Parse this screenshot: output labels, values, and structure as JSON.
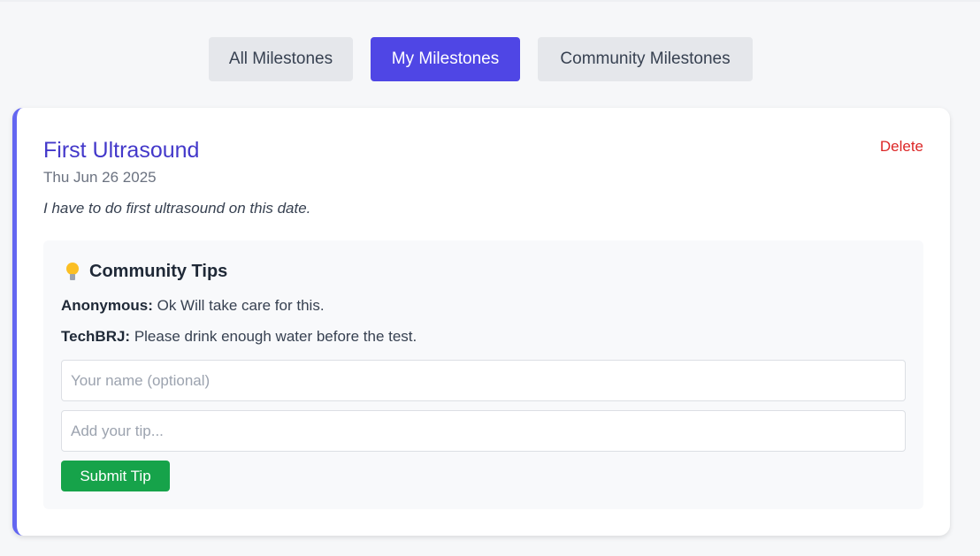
{
  "tabs": [
    {
      "label": "All Milestones",
      "active": false
    },
    {
      "label": "My Milestones",
      "active": true
    },
    {
      "label": "Community Milestones",
      "active": false
    }
  ],
  "milestone": {
    "title": "First Ultrasound",
    "date": "Thu Jun 26 2025",
    "description": "I have to do first ultrasound on this date.",
    "delete_label": "Delete"
  },
  "tips": {
    "icon": "lightbulb-icon",
    "title": "Community Tips",
    "items": [
      {
        "author": "Anonymous:",
        "text": " Ok Will take care for this."
      },
      {
        "author": "TechBRJ:",
        "text": " Please drink enough water before the test."
      }
    ],
    "name_placeholder": "Your name (optional)",
    "tip_placeholder": "Add your tip...",
    "submit_label": "Submit Tip"
  },
  "colors": {
    "accent": "#4f46e5",
    "title": "#4338ca",
    "danger": "#dc2626",
    "success": "#16a34a"
  }
}
